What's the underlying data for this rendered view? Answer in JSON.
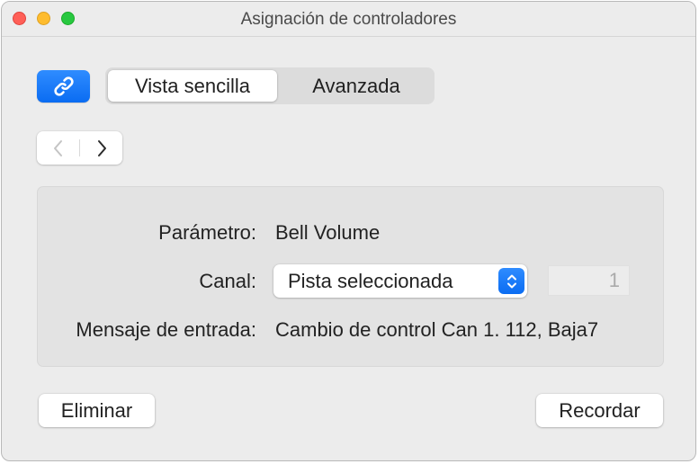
{
  "window": {
    "title": "Asignación de controladores"
  },
  "toolbar": {
    "link_icon": "link-icon",
    "view_tabs": [
      {
        "label": "Vista sencilla",
        "selected": true
      },
      {
        "label": "Avanzada",
        "selected": false
      }
    ]
  },
  "navigation": {
    "prev_icon": "chevron-left-icon",
    "next_icon": "chevron-right-icon"
  },
  "details": {
    "parameter_label": "Parámetro:",
    "parameter_value": "Bell Volume",
    "channel_label": "Canal:",
    "channel_value": "Pista seleccionada",
    "channel_number": "1",
    "input_label": "Mensaje de entrada:",
    "input_value": "Cambio de control Can 1. 112, Baja7"
  },
  "buttons": {
    "delete_label": "Eliminar",
    "learn_label": "Recordar"
  },
  "colors": {
    "accent": "#0a6cf2",
    "close": "#ff5f57",
    "minimize": "#febc2e",
    "zoom": "#28c840"
  }
}
